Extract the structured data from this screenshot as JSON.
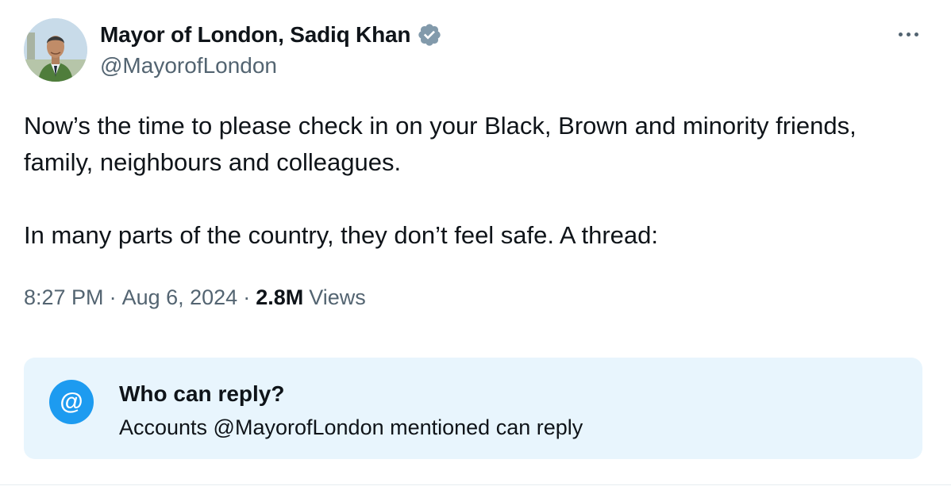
{
  "author": {
    "display_name": "Mayor of London, Sadiq Khan",
    "handle": "@MayorofLondon",
    "verified_badge_color": "#829aab"
  },
  "tweet": {
    "paragraphs": [
      "Now’s the time to please check in on your Black, Brown and minority friends, family, neighbours and colleagues.",
      "In many parts of the country, they don’t feel safe. A thread:"
    ],
    "time": "8:27 PM",
    "date": "Aug 6, 2024",
    "views_count": "2.8M",
    "views_label": "Views"
  },
  "reply_settings": {
    "icon_glyph": "@",
    "title": "Who can reply?",
    "description": "Accounts @MayorofLondon mentioned can reply"
  },
  "icons": {
    "more": "more-horizontal-icon",
    "verified": "verified-badge-icon",
    "mention": "at-icon"
  },
  "colors": {
    "accent": "#1d9bf0",
    "text_primary": "#0f1419",
    "text_secondary": "#536471",
    "reply_box_bg": "#e8f5fd"
  }
}
